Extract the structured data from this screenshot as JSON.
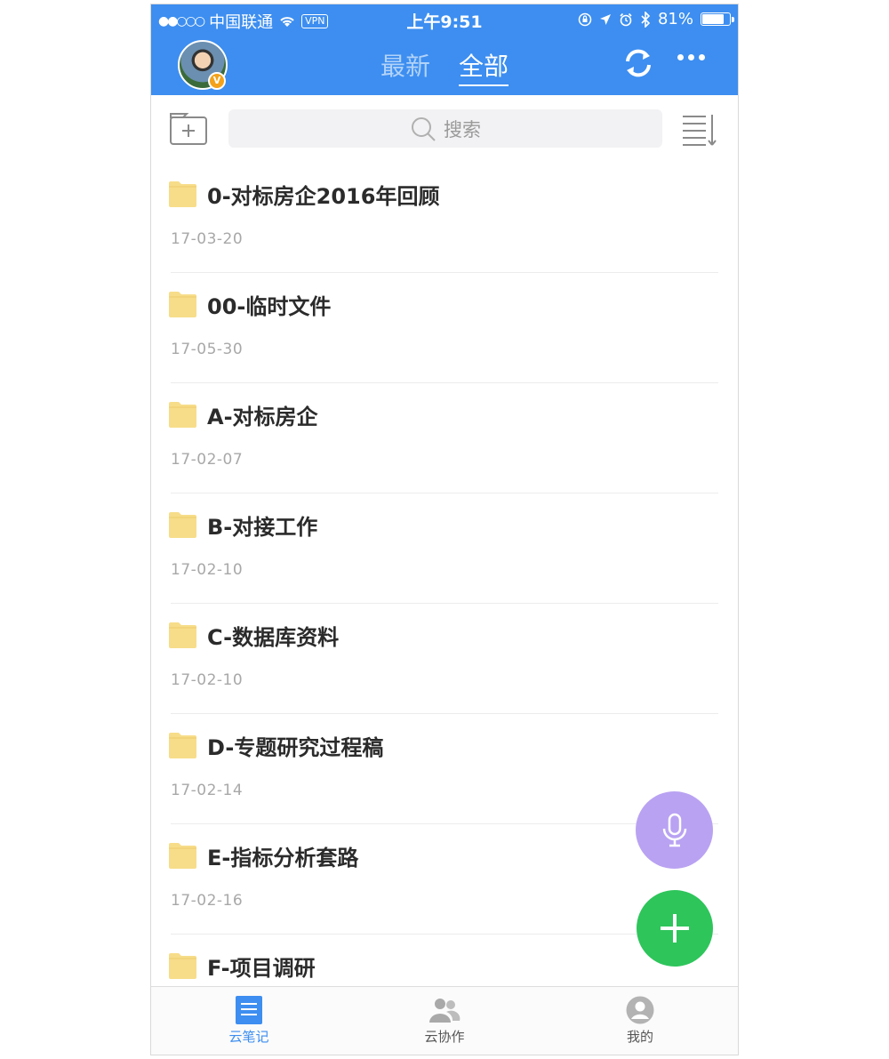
{
  "status_bar": {
    "carrier": "中国联通",
    "signal": "●●○○○",
    "vpn": "VPN",
    "time": "上午9:51",
    "battery_percent": "81%",
    "battery_level": 0.81
  },
  "header": {
    "tabs": [
      {
        "label": "最新",
        "active": false
      },
      {
        "label": "全部",
        "active": true
      }
    ],
    "avatar_badge": "V"
  },
  "toolbar": {
    "search_label": "搜索"
  },
  "folders": [
    {
      "name": "0-对标房企2016年回顾",
      "date": "17-03-20"
    },
    {
      "name": "00-临时文件",
      "date": "17-05-30"
    },
    {
      "name": "A-对标房企",
      "date": "17-02-07"
    },
    {
      "name": "B-对接工作",
      "date": "17-02-10"
    },
    {
      "name": "C-数据库资料",
      "date": "17-02-10"
    },
    {
      "name": "D-专题研究过程稿",
      "date": "17-02-14"
    },
    {
      "name": "E-指标分析套路",
      "date": "17-02-16"
    },
    {
      "name": "F-项目调研",
      "date": ""
    }
  ],
  "tabbar": {
    "items": [
      {
        "label": "云笔记",
        "icon": "note-icon",
        "active": true
      },
      {
        "label": "云协作",
        "icon": "people-icon",
        "active": false
      },
      {
        "label": "我的",
        "icon": "profile-icon",
        "active": false
      }
    ]
  },
  "colors": {
    "accent": "#3d8ef0",
    "folder": "#f7dd8a",
    "fab_voice": "#b9a2f2",
    "fab_add": "#2ec55b"
  }
}
